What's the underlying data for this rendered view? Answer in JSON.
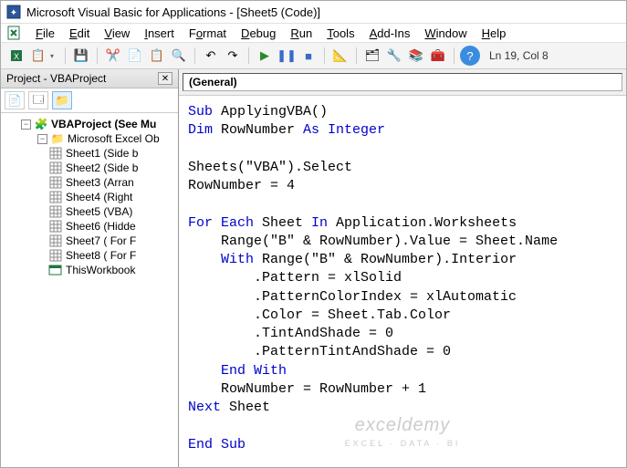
{
  "title": "Microsoft Visual Basic for Applications - [Sheet5 (Code)]",
  "menu": {
    "items": [
      {
        "label": "File",
        "u": "F"
      },
      {
        "label": "Edit",
        "u": "E"
      },
      {
        "label": "View",
        "u": "V"
      },
      {
        "label": "Insert",
        "u": "I"
      },
      {
        "label": "Format",
        "u": "o"
      },
      {
        "label": "Debug",
        "u": "D"
      },
      {
        "label": "Run",
        "u": "R"
      },
      {
        "label": "Tools",
        "u": "T"
      },
      {
        "label": "Add-Ins",
        "u": "A"
      },
      {
        "label": "Window",
        "u": "W"
      },
      {
        "label": "Help",
        "u": "H"
      }
    ]
  },
  "toolbar": {
    "status": "Ln 19, Col 8"
  },
  "project": {
    "pane_title": "Project - VBAProject",
    "root": "VBAProject (See Mu",
    "folder": "Microsoft Excel Ob",
    "sheets": [
      "Sheet1 (Side b",
      "Sheet2 (Side b",
      "Sheet3 (Arran",
      "Sheet4 (Right",
      "Sheet5 (VBA)",
      "Sheet6 (Hidde",
      "Sheet7 ( For F",
      "Sheet8 ( For F"
    ],
    "workbook": "ThisWorkbook"
  },
  "code": {
    "combo": "(General)",
    "tokens": [
      [
        {
          "t": "Sub",
          "k": 1
        },
        {
          "t": " ApplyingVBA()"
        }
      ],
      [
        {
          "t": "Dim",
          "k": 1
        },
        {
          "t": " RowNumber "
        },
        {
          "t": "As Integer",
          "k": 1
        }
      ],
      [],
      [
        {
          "t": "Sheets(\"VBA\").Select"
        }
      ],
      [
        {
          "t": "RowNumber = 4"
        }
      ],
      [],
      [
        {
          "t": "For Each",
          "k": 1
        },
        {
          "t": " Sheet "
        },
        {
          "t": "In",
          "k": 1
        },
        {
          "t": " Application.Worksheets"
        }
      ],
      [
        {
          "t": "    Range(\"B\" & RowNumber).Value = Sheet.Name"
        }
      ],
      [
        {
          "t": "    "
        },
        {
          "t": "With",
          "k": 1
        },
        {
          "t": " Range(\"B\" & RowNumber).Interior"
        }
      ],
      [
        {
          "t": "        .Pattern = xlSolid"
        }
      ],
      [
        {
          "t": "        .PatternColorIndex = xlAutomatic"
        }
      ],
      [
        {
          "t": "        .Color = Sheet.Tab.Color"
        }
      ],
      [
        {
          "t": "        .TintAndShade = 0"
        }
      ],
      [
        {
          "t": "        .PatternTintAndShade = 0"
        }
      ],
      [
        {
          "t": "    "
        },
        {
          "t": "End With",
          "k": 1
        }
      ],
      [
        {
          "t": "    RowNumber = RowNumber + 1"
        }
      ],
      [
        {
          "t": "Next",
          "k": 1
        },
        {
          "t": " Sheet"
        }
      ],
      [],
      [
        {
          "t": "End Sub",
          "k": 1
        }
      ]
    ]
  },
  "watermark": {
    "line1": "exceldemy",
    "line2": "EXCEL · DATA · BI"
  }
}
